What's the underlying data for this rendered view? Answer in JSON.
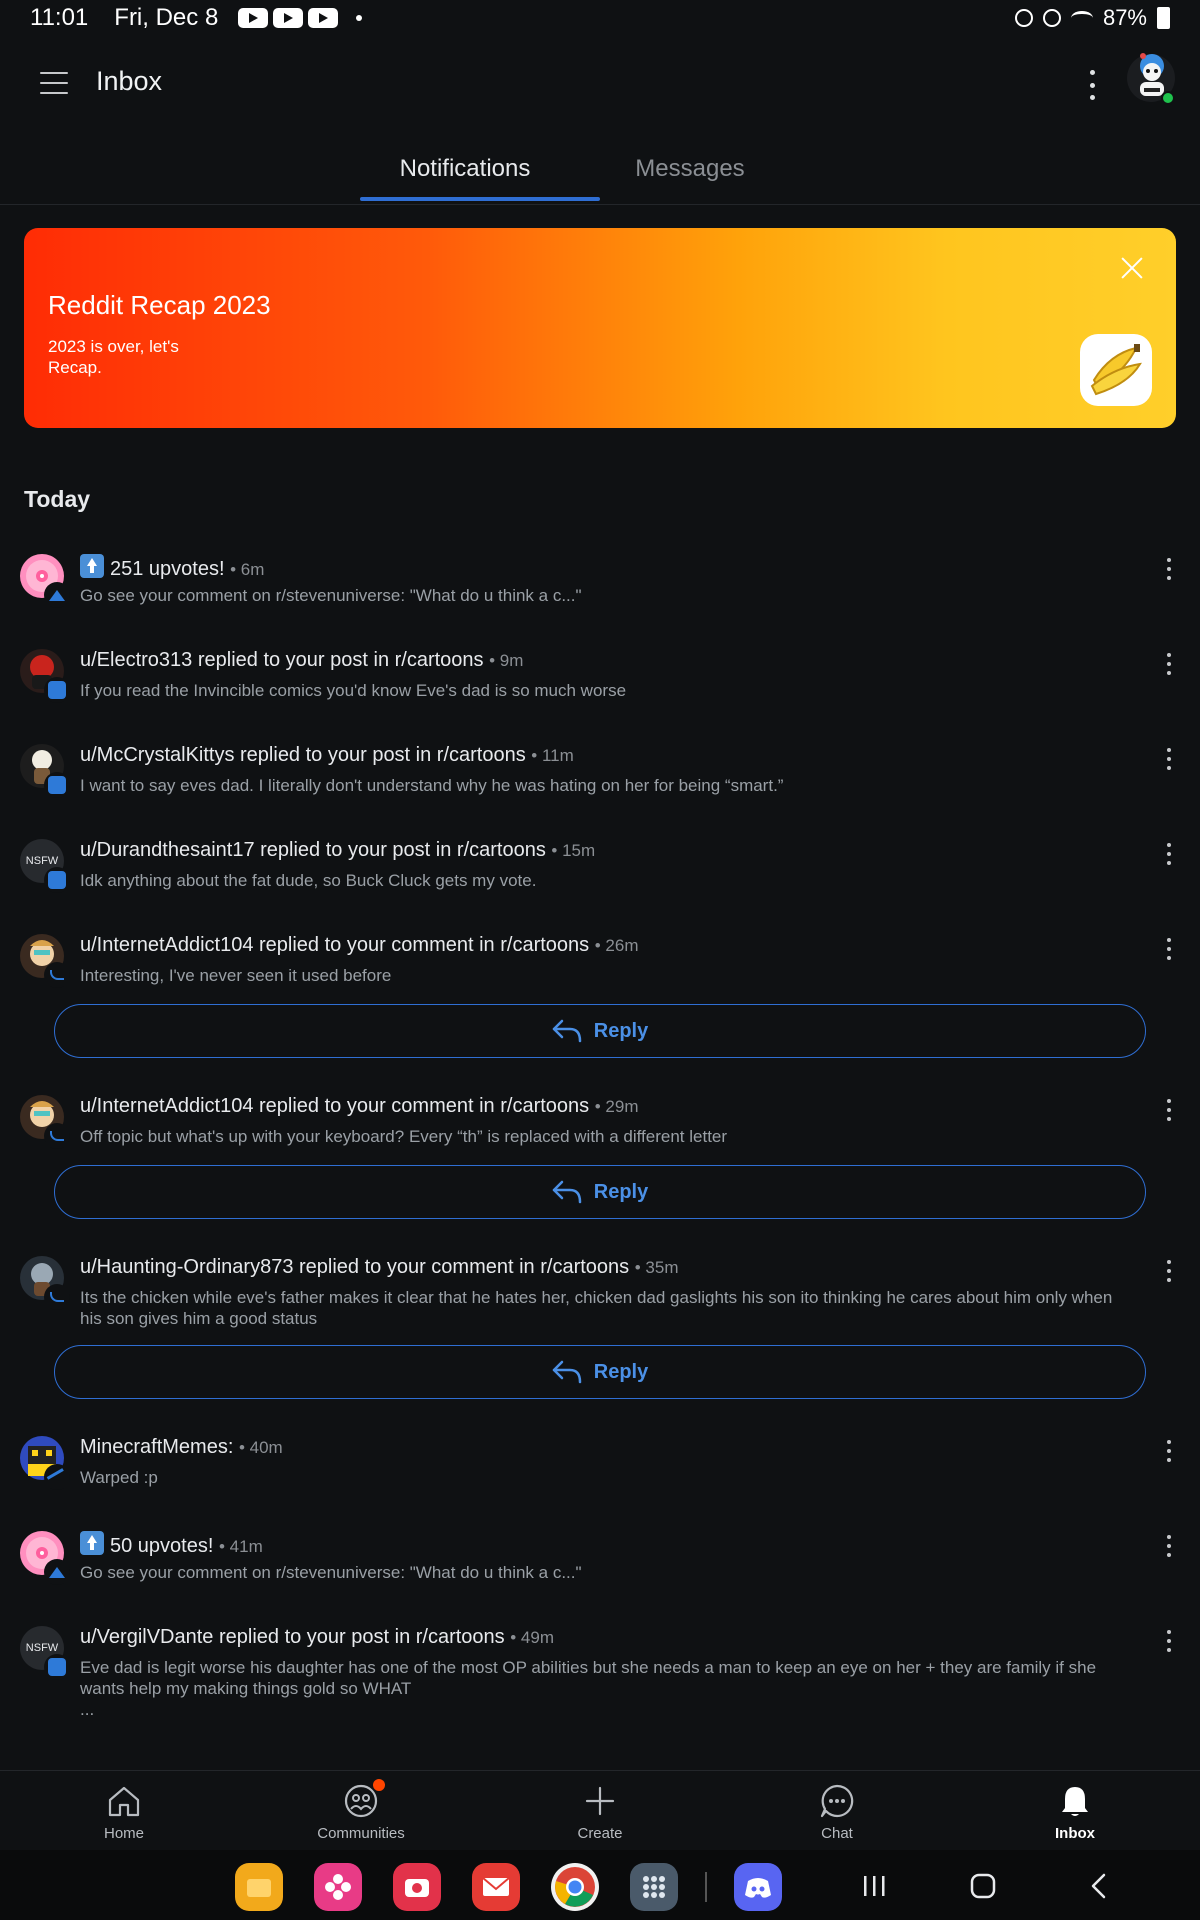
{
  "status_bar": {
    "time": "11:01",
    "date": "Fri, Dec 8",
    "battery": "87%",
    "icons": [
      "youtube-icon",
      "youtube-icon",
      "youtube-icon",
      "dot-icon",
      "alarm-icon",
      "clock-icon",
      "wifi-icon",
      "battery-icon"
    ]
  },
  "app_bar": {
    "title": "Inbox"
  },
  "tabs": [
    {
      "label": "Notifications",
      "active": true
    },
    {
      "label": "Messages",
      "active": false
    }
  ],
  "recap_banner": {
    "title": "Reddit Recap 2023",
    "subtitle": "2023 is over, let's Recap."
  },
  "section": {
    "title": "Today"
  },
  "notifications": [
    {
      "title": "251 upvotes!",
      "time": "• 6m",
      "body": "Go see your comment on r/stevenuniverse: \"What do u think a c...\"",
      "badge": "upvote"
    },
    {
      "title": "u/Electro313 replied to your post in r/cartoons",
      "time": "• 9m",
      "body": "If you read the Invincible comics you'd know Eve's dad is so much worse",
      "badge": "comment"
    },
    {
      "title": "u/McCrystalKittys replied to your post in r/cartoons",
      "time": "• 11m",
      "body": "I want to say eves dad. I literally don't understand why he was hating on her for being “smart.”",
      "badge": "comment"
    },
    {
      "title": "u/Durandthesaint17 replied to your post in r/cartoons",
      "time": "• 15m",
      "body": "Idk anything about the fat dude, so Buck Cluck gets my vote.",
      "badge": "comment",
      "avatar_text": "NSFW"
    },
    {
      "title": "u/InternetAddict104 replied to your comment in r/cartoons",
      "time": "• 26m",
      "body": "Interesting, I've never seen it used before",
      "badge": "reply",
      "reply_label": "Reply"
    },
    {
      "title": "u/InternetAddict104 replied to your comment in r/cartoons",
      "time": "• 29m",
      "body": "Off topic but what's up with your keyboard? Every “th” is replaced with a different letter",
      "badge": "reply",
      "reply_label": "Reply"
    },
    {
      "title": "u/Haunting-Ordinary873 replied to your comment in r/cartoons",
      "time": "• 35m",
      "body": "Its the chicken while eve's father makes it clear that he hates her, chicken dad gaslights his son ito thinking he cares about him only when his son gives him a good status",
      "badge": "reply",
      "reply_label": "Reply"
    },
    {
      "title": "MinecraftMemes:",
      "time": "• 40m",
      "body": "Warped :p",
      "badge": "trending"
    },
    {
      "title": "50 upvotes!",
      "time": "• 41m",
      "body": "Go see your comment on r/stevenuniverse: \"What do u think a c...\"",
      "badge": "upvote"
    },
    {
      "title": "u/VergilVDante replied to your post in r/cartoons",
      "time": "• 49m",
      "body": "Eve dad is legit worse his daughter has one of the most OP abilities but she needs a man to keep an eye on her + they are family if she wants help my making things gold so WHAT\n...",
      "badge": "comment",
      "avatar_text": "NSFW"
    }
  ],
  "bottom_nav": [
    {
      "label": "Home",
      "icon": "home-icon"
    },
    {
      "label": "Communities",
      "icon": "communities-icon"
    },
    {
      "label": "Create",
      "icon": "plus-icon"
    },
    {
      "label": "Chat",
      "icon": "chat-icon"
    },
    {
      "label": "Inbox",
      "icon": "bell-icon",
      "active": true
    }
  ],
  "dock_apps": [
    "files-app",
    "flower-app",
    "camera-app",
    "mail-app",
    "chrome-app",
    "apps-grid",
    "discord-app"
  ],
  "colors": {
    "background": "#0f1113",
    "accent": "#2f6ed3",
    "reddit_orange": "#ff4500"
  }
}
